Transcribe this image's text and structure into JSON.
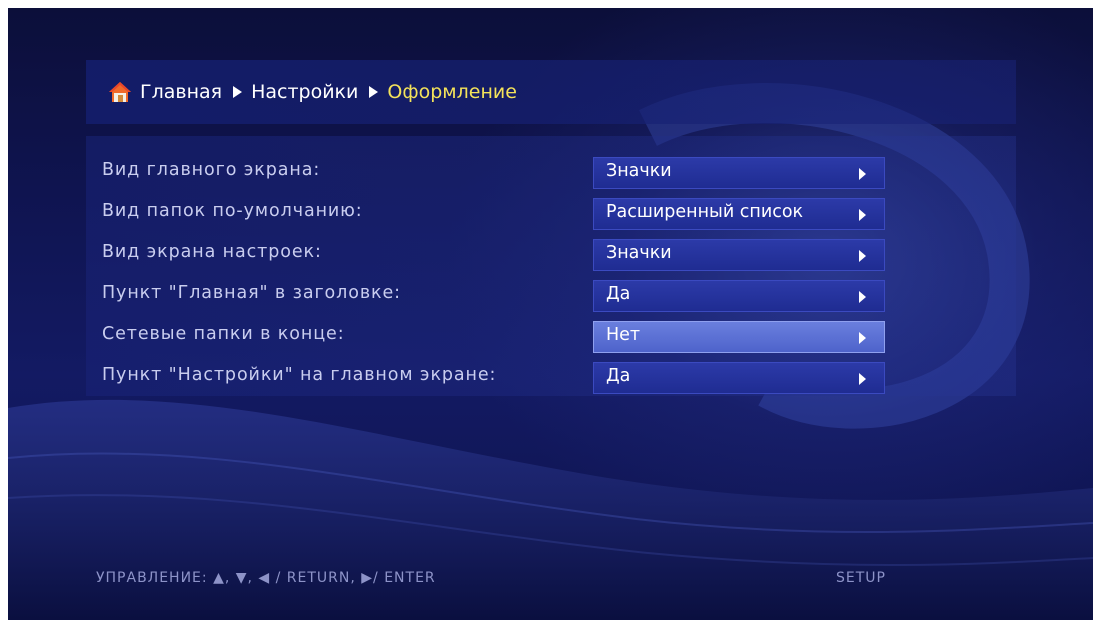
{
  "breadcrumb": {
    "items": [
      "Главная",
      "Настройки",
      "Оформление"
    ]
  },
  "settings": [
    {
      "label": "Вид главного экрана:",
      "value": "Значки"
    },
    {
      "label": "Вид папок по-умолчанию:",
      "value": "Расширенный список"
    },
    {
      "label": "Вид экрана настроек:",
      "value": "Значки"
    },
    {
      "label": "Пункт \"Главная\" в заголовке:",
      "value": "Да"
    },
    {
      "label": "Сетевые папки в конце:",
      "value": "Нет"
    },
    {
      "label": "Пункт \"Настройки\" на главном экране:",
      "value": "Да"
    }
  ],
  "focused_index": 4,
  "footer": {
    "controls": "УПРАВЛЕНИЕ:  ▲, ▼, ◀ / RETURN, ▶/ ENTER",
    "setup": "SETUP"
  },
  "icons": {
    "home": "home-icon",
    "breadcrumb_separator": "chevron-right-icon",
    "value_arrow": "chevron-right-icon"
  },
  "colors": {
    "current_crumb": "#f4e35a",
    "focused_value": "#5a70d6"
  }
}
